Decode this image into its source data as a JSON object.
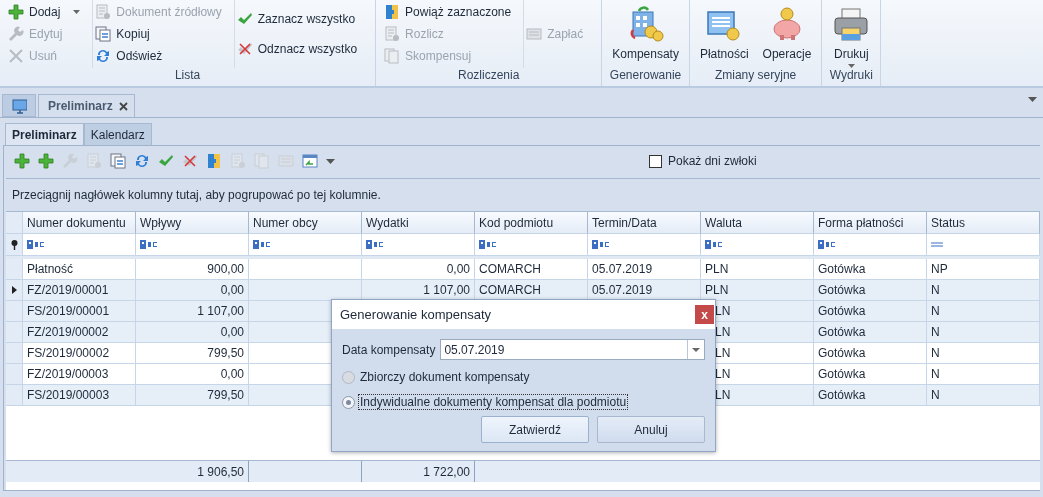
{
  "ribbon": {
    "groups": [
      {
        "label": "Lista",
        "columns": [
          [
            {
              "label": "Dodaj",
              "kind": "small",
              "disabled": false,
              "dropdown": true
            },
            {
              "label": "Edytuj",
              "kind": "small",
              "disabled": true,
              "dropdown": false
            },
            {
              "label": "Usuń",
              "kind": "small",
              "disabled": true,
              "dropdown": false
            }
          ],
          [
            {
              "label": "Dokument źródłowy",
              "kind": "small",
              "disabled": true,
              "dropdown": false
            },
            {
              "label": "Kopiuj",
              "kind": "small",
              "disabled": false,
              "dropdown": false
            },
            {
              "label": "Odśwież",
              "kind": "small",
              "disabled": false,
              "dropdown": false
            }
          ],
          [
            {
              "label": "Zaznacz wszystko",
              "kind": "small",
              "disabled": false,
              "dropdown": false
            },
            {
              "label": "Odznacz wszystko",
              "kind": "small",
              "disabled": false,
              "dropdown": false
            }
          ]
        ]
      },
      {
        "label": "Rozliczenia",
        "columns": [
          [
            {
              "label": "Powiąż zaznaczone",
              "kind": "small",
              "disabled": false,
              "dropdown": false
            },
            {
              "label": "Rozlicz",
              "kind": "small",
              "disabled": true,
              "dropdown": false
            },
            {
              "label": "Skompensuj",
              "kind": "small",
              "disabled": true,
              "dropdown": false
            }
          ],
          [
            {
              "label": "Zapłać",
              "kind": "small",
              "disabled": true,
              "dropdown": false
            }
          ]
        ]
      },
      {
        "label": "Generowanie",
        "columns": [
          [
            {
              "label": "Kompensaty",
              "kind": "large",
              "disabled": false,
              "dropdown": false
            }
          ]
        ]
      },
      {
        "label": "Zmiany seryjne",
        "columns": [
          [
            {
              "label": "Płatności",
              "kind": "large",
              "disabled": false,
              "dropdown": false
            },
            {
              "label": "Operacje",
              "kind": "large",
              "disabled": false,
              "dropdown": false
            }
          ]
        ]
      },
      {
        "label": "Wydruki",
        "columns": [
          [
            {
              "label": "Drukuj",
              "kind": "large",
              "disabled": false,
              "dropdown": true
            }
          ]
        ]
      }
    ]
  },
  "document_tabs": [
    {
      "label": "Preliminarz",
      "selected": true
    }
  ],
  "inner_tabs": [
    {
      "label": "Preliminarz",
      "selected": true
    },
    {
      "label": "Kalendarz",
      "selected": false
    }
  ],
  "toolbar": {
    "buttons": [
      {
        "disabled": false
      },
      {
        "disabled": false
      },
      {
        "disabled": true
      },
      {
        "disabled": true
      },
      {
        "disabled": false
      },
      {
        "disabled": false
      },
      {
        "disabled": false
      },
      {
        "disabled": false
      },
      {
        "disabled": false
      },
      {
        "disabled": true
      },
      {
        "disabled": true
      },
      {
        "disabled": true
      },
      {
        "disabled": false
      }
    ],
    "checkbox": {
      "label": "Pokaż dni zwłoki",
      "checked": false
    }
  },
  "group_panel": {
    "hint": "Przeciągnij nagłówek kolumny tutaj, aby pogrupować po tej kolumnie."
  },
  "table": {
    "columns": [
      "Numer dokumentu",
      "Wpływy",
      "Numer obcy",
      "Wydatki",
      "Kod podmiotu",
      "Termin/Data",
      "Waluta",
      "Forma płatności",
      "Status"
    ],
    "rows": [
      {
        "numer": "Płatność",
        "wplywy": "900,00",
        "wydatki": "0,00",
        "kod": "COMARCH",
        "termin": "05.07.2019",
        "waluta": "PLN",
        "forma": "Gotówka",
        "status": "NP",
        "current": false,
        "selected": false
      },
      {
        "numer": "FZ/2019/00001",
        "wplywy": "0,00",
        "wydatki": "1 107,00",
        "kod": "COMARCH",
        "termin": "05.07.2019",
        "waluta": "PLN",
        "forma": "Gotówka",
        "status": "N",
        "current": true,
        "selected": true
      },
      {
        "numer": "FS/2019/00001",
        "wplywy": "1 107,00",
        "waluta": "LN",
        "forma": "Gotówka",
        "status": "N",
        "current": false,
        "selected": true
      },
      {
        "numer": "FZ/2019/00002",
        "wplywy": "0,00",
        "waluta": "LN",
        "forma": "Gotówka",
        "status": "N",
        "current": false,
        "selected": true
      },
      {
        "numer": "FS/2019/00002",
        "wplywy": "799,50",
        "waluta": "LN",
        "forma": "Gotówka",
        "status": "N",
        "current": false,
        "selected": false
      },
      {
        "numer": "FZ/2019/00003",
        "wplywy": "0,00",
        "waluta": "LN",
        "forma": "Gotówka",
        "status": "N",
        "current": false,
        "selected": false
      },
      {
        "numer": "FS/2019/00003",
        "wplywy": "799,50",
        "waluta": "LN",
        "forma": "Gotówka",
        "status": "N",
        "current": false,
        "selected": true
      }
    ],
    "totals": {
      "wplywy": "1 906,50",
      "wydatki": "1 722,00"
    }
  },
  "dialog": {
    "title": "Generowanie kompensaty",
    "close": "x",
    "date_label": "Data kompensaty",
    "date_value": "05.07.2019",
    "options": [
      {
        "label": "Zbiorczy dokument kompensaty",
        "selected": false,
        "disabled": true,
        "focused": false
      },
      {
        "label": "Indywidualne dokumenty kompensat dla podmiotu",
        "selected": true,
        "disabled": false,
        "focused": true
      }
    ],
    "buttons": [
      {
        "label": "Zatwierdź",
        "default": true
      },
      {
        "label": "Anuluj",
        "default": false
      }
    ]
  }
}
